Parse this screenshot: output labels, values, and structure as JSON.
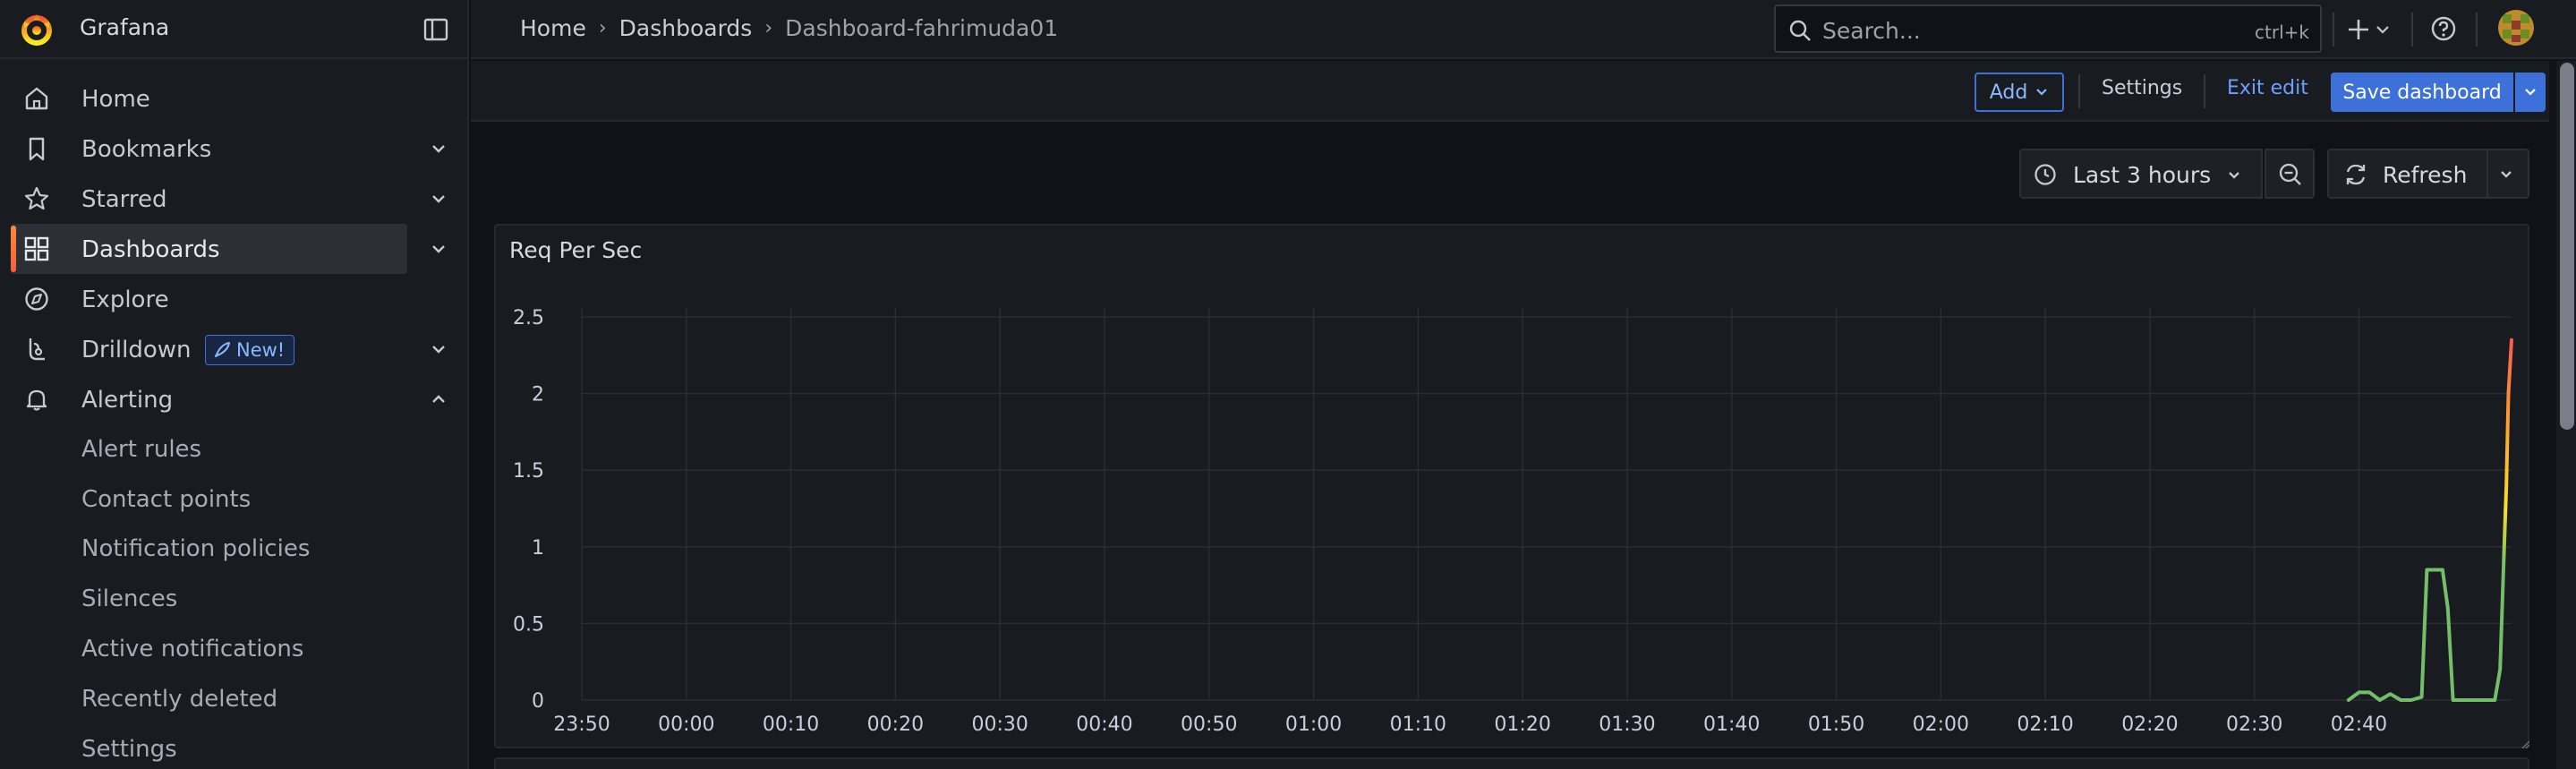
{
  "app": {
    "name": "Grafana"
  },
  "sidebar": {
    "items": [
      {
        "label": "Home",
        "icon": "home-icon",
        "expandable": false
      },
      {
        "label": "Bookmarks",
        "icon": "bookmark-icon",
        "expandable": true
      },
      {
        "label": "Starred",
        "icon": "star-icon",
        "expandable": true
      },
      {
        "label": "Dashboards",
        "icon": "dashboards-icon",
        "expandable": true,
        "active": true
      },
      {
        "label": "Explore",
        "icon": "compass-icon",
        "expandable": false
      },
      {
        "label": "Drilldown",
        "icon": "drilldown-icon",
        "expandable": true,
        "badge": "New!"
      },
      {
        "label": "Alerting",
        "icon": "bell-icon",
        "expandable": true,
        "expanded": true
      }
    ],
    "alerting_children": [
      "Alert rules",
      "Contact points",
      "Notification policies",
      "Silences",
      "Active notifications",
      "Recently deleted",
      "Settings"
    ]
  },
  "breadcrumbs": [
    "Home",
    "Dashboards",
    "Dashboard-fahrimuda01"
  ],
  "search": {
    "placeholder": "Search...",
    "shortcut": "ctrl+k"
  },
  "toolbar": {
    "add_label": "Add",
    "settings_label": "Settings",
    "exit_edit_label": "Exit edit",
    "save_label": "Save dashboard"
  },
  "controls": {
    "time_range": "Last 3 hours",
    "refresh_label": "Refresh"
  },
  "panel": {
    "title": "Req Per Sec"
  },
  "colors": {
    "accent_orange": "#f55f3e",
    "primary_blue": "#3d71d9",
    "series_green": "#73bf69",
    "series_yellow": "#fade2a",
    "series_red": "#f2495c"
  },
  "chart_data": {
    "type": "line",
    "title": "Req Per Sec",
    "x_ticks": [
      "23:50",
      "00:00",
      "00:10",
      "00:20",
      "00:30",
      "00:40",
      "00:50",
      "01:00",
      "01:10",
      "01:20",
      "01:30",
      "01:40",
      "01:50",
      "02:00",
      "02:10",
      "02:20",
      "02:30",
      "02:40"
    ],
    "y_ticks": [
      "0",
      "0.5",
      "1",
      "1.5",
      "2",
      "2.5"
    ],
    "ylim": [
      0,
      2.5
    ],
    "xlim_minutes_from_2350": [
      0,
      180
    ],
    "grid": true,
    "color_scheme": "green-yellow-red by value",
    "series": [
      {
        "x_minutes_from_2350": [
          169,
          170,
          171,
          172,
          173,
          174,
          175,
          176,
          176.5,
          177,
          177.5,
          178,
          178.5,
          179,
          179.5,
          180,
          181,
          182,
          182.5,
          183,
          183.5,
          183.9,
          184.1,
          184.3,
          184.6
        ],
        "values": [
          0,
          0.05,
          0.05,
          0,
          0.04,
          0,
          0,
          0.02,
          0.85,
          0.85,
          0.85,
          0.85,
          0.6,
          0,
          0,
          0,
          0,
          0,
          0,
          0,
          0.2,
          1.0,
          1.4,
          2.0,
          2.35
        ]
      }
    ]
  }
}
